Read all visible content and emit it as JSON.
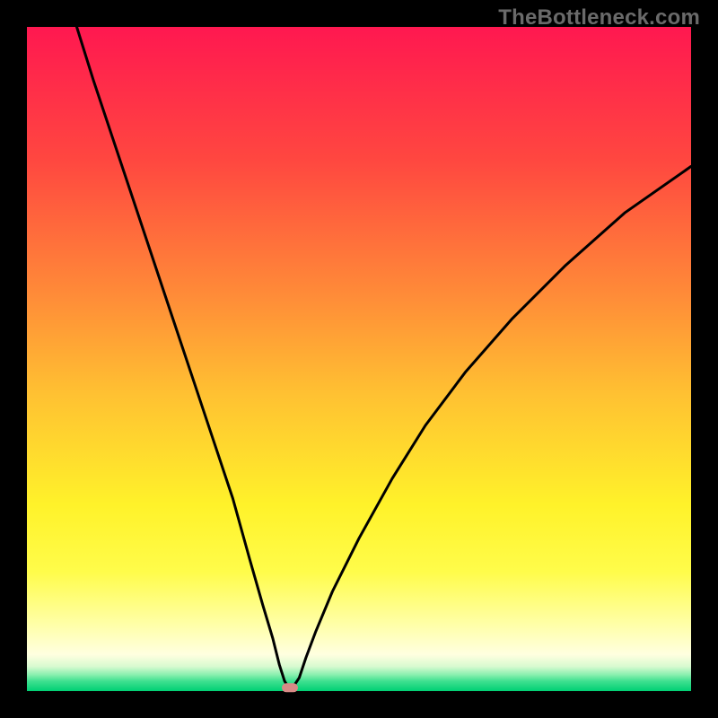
{
  "watermark": "TheBottleneck.com",
  "chart_data": {
    "type": "line",
    "title": "",
    "xlabel": "",
    "ylabel": "",
    "xlim": [
      0,
      100
    ],
    "ylim": [
      0,
      100
    ],
    "grid": false,
    "legend": false,
    "watermark": "TheBottleneck.com",
    "background": {
      "type": "vertical-gradient",
      "stops": [
        {
          "pos": 0.0,
          "color": "#ff1850"
        },
        {
          "pos": 0.2,
          "color": "#ff4740"
        },
        {
          "pos": 0.4,
          "color": "#ff8a38"
        },
        {
          "pos": 0.55,
          "color": "#ffc032"
        },
        {
          "pos": 0.72,
          "color": "#fff22a"
        },
        {
          "pos": 0.82,
          "color": "#fffc4a"
        },
        {
          "pos": 0.9,
          "color": "#ffffa8"
        },
        {
          "pos": 0.945,
          "color": "#ffffe0"
        },
        {
          "pos": 0.963,
          "color": "#d8fad0"
        },
        {
          "pos": 0.975,
          "color": "#8cf0b0"
        },
        {
          "pos": 0.985,
          "color": "#40e090"
        },
        {
          "pos": 1.0,
          "color": "#00d074"
        }
      ]
    },
    "series": [
      {
        "name": "bottleneck-curve",
        "x": [
          7.5,
          10,
          13,
          16,
          19,
          22,
          25,
          28,
          31,
          33.5,
          35.5,
          37,
          38,
          38.8,
          39.4,
          40,
          41,
          42,
          43.5,
          46,
          50,
          55,
          60,
          66,
          73,
          81,
          90,
          100
        ],
        "y": [
          100,
          92,
          83,
          74,
          65,
          56,
          47,
          38,
          29,
          20,
          13,
          8,
          4,
          1.5,
          0.5,
          0.5,
          2,
          5,
          9,
          15,
          23,
          32,
          40,
          48,
          56,
          64,
          72,
          79
        ]
      }
    ],
    "markers": [
      {
        "name": "optimal-point",
        "x": 39.6,
        "y": 0.5,
        "shape": "rounded-rect",
        "color": "#d88a86"
      }
    ],
    "frame": {
      "outer_size": 800,
      "inner_margin": 30,
      "frame_color": "#000000"
    }
  }
}
